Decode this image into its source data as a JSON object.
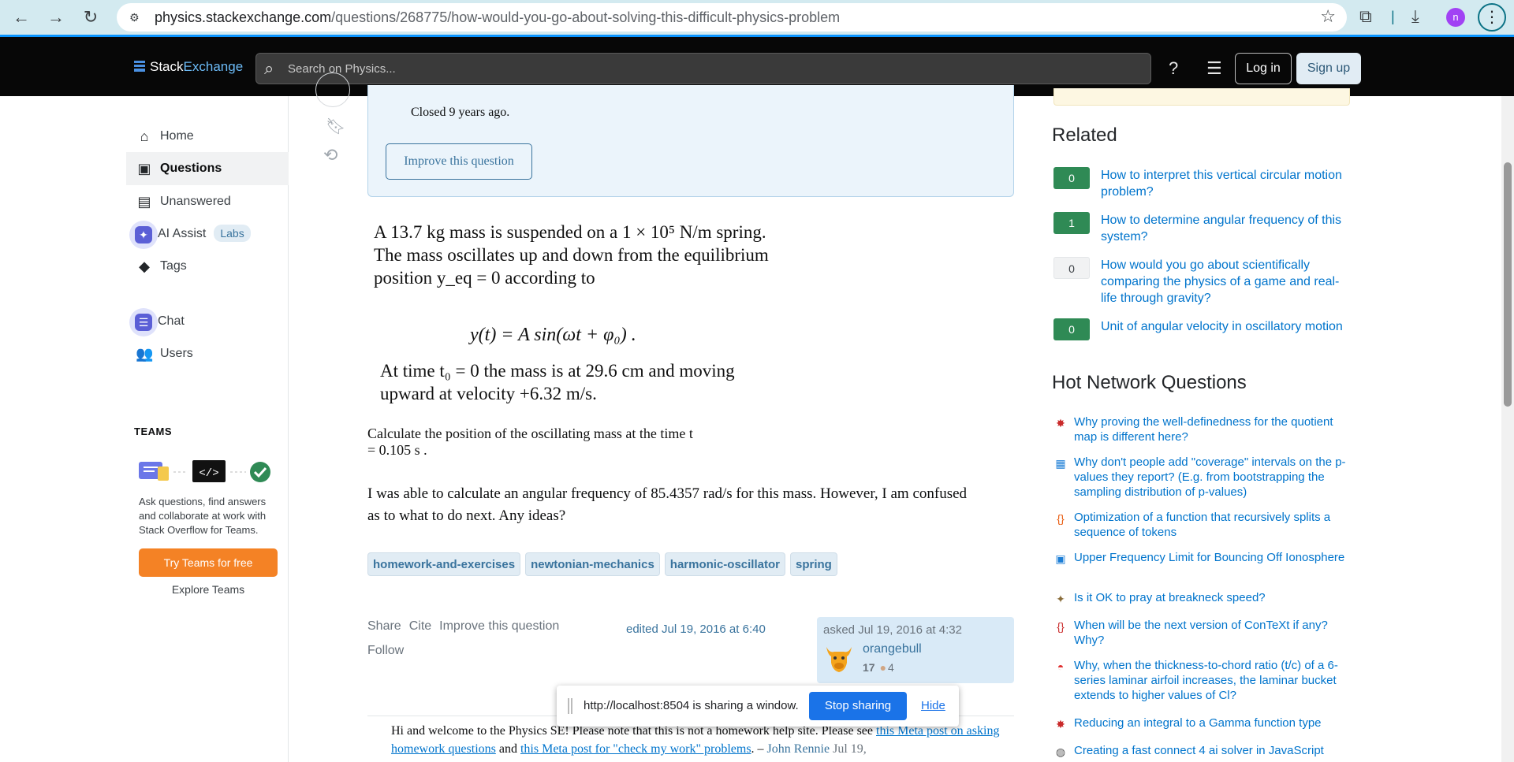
{
  "browser": {
    "url_domain": "physics.stackexchange.com",
    "url_path": "/questions/268775/how-would-you-go-about-solving-this-difficult-physics-problem",
    "profile_initial": "n"
  },
  "topbar": {
    "logo_stack": "Stack",
    "logo_exchange": "Exchange",
    "search_placeholder": "Search on Physics...",
    "login": "Log in",
    "signup": "Sign up"
  },
  "nav": {
    "home": "Home",
    "questions": "Questions",
    "unanswered": "Unanswered",
    "ai_assist": "AI Assist",
    "labs": "Labs",
    "tags": "Tags",
    "chat": "Chat",
    "users": "Users"
  },
  "teams": {
    "title": "TEAMS",
    "desc": "Ask questions, find answers and collaborate at work with Stack Overflow for Teams.",
    "try": "Try Teams for free",
    "explore": "Explore Teams"
  },
  "notice": {
    "closed": "Closed 9 years ago.",
    "improve": "Improve this question"
  },
  "question": {
    "img_p1": "A 13.7 kg mass is suspended on a 1 × 10⁵ N/m spring. The mass oscillates up and down from the equilibrium position y_eq = 0 according to",
    "img_eq": "y(t) = A sin(ωt + φ₀) .",
    "img_p2": "At time t₀ = 0 the mass is at 29.6 cm and moving upward at velocity +6.32 m/s.",
    "img_p3": "Calculate the position of the oscillating mass at the time t = 0.105 s .",
    "text": "I was able to calculate an angular frequency of 85.4357 rad/s for this mass. However, I am confused as to what to do next. Any ideas?",
    "tags": [
      "homework-and-exercises",
      "newtonian-mechanics",
      "harmonic-oscillator",
      "spring"
    ],
    "share": "Share",
    "cite": "Cite",
    "improve": "Improve this question",
    "follow": "Follow",
    "edited": "edited Jul 19, 2016 at 6:40",
    "asked": "asked Jul 19, 2016 at 4:32",
    "user": "orangebull",
    "rep": "17",
    "bronze": "4"
  },
  "comment": {
    "pre": "Hi and welcome to the Physics SE! Please note that this is not a homework help site. Please see ",
    "link1": "this Meta post on asking homework questions",
    "mid": " and ",
    "link2": "this Meta post for \"check my work\" problems",
    "dash": ". – ",
    "author": "John Rennie",
    "date": " Jul 19,"
  },
  "sharebar": {
    "msg": "http://localhost:8504 is sharing a window.",
    "stop": "Stop sharing",
    "hide": "Hide"
  },
  "related": {
    "title": "Related",
    "items": [
      {
        "score": "0",
        "title": "How to interpret this vertical circular motion problem?"
      },
      {
        "score": "1",
        "title": "How to determine angular frequency of this system?"
      },
      {
        "score": "0",
        "title": "How would you go about scientifically comparing the physics of a game and real-life through gravity?"
      },
      {
        "score": "0",
        "title": "Unit of angular velocity in oscillatory motion"
      }
    ]
  },
  "hot": {
    "title": "Hot Network Questions",
    "items": [
      {
        "title": "Why proving the well-definedness for the quotient map is different here?",
        "icon": "math-icon"
      },
      {
        "title": "Why don't people add \"coverage\" intervals on the p-values they report? (E.g. from bootstrapping the sampling distribution of p-values)",
        "icon": "stats-icon"
      },
      {
        "title": "Optimization of a function that recursively splits a sequence of tokens",
        "icon": "codereview-icon"
      },
      {
        "title": "Upper Frequency Limit for Bouncing Off Ionosphere",
        "icon": "ham-icon"
      },
      {
        "title": "Is it OK to pray at breakneck speed?",
        "icon": "judaism-icon"
      },
      {
        "title": "When will be the next version of ConTeXt if any? Why?",
        "icon": "tex-icon"
      },
      {
        "title": "Why, when the thickness-to-chord ratio (t/c) of a 6-series laminar airfoil increases, the laminar bucket extends to higher values of Cl?",
        "icon": "aviation-icon"
      },
      {
        "title": "Reducing an integral to a Gamma function type",
        "icon": "math-icon"
      },
      {
        "title": "Creating a fast connect 4 ai solver in JavaScript",
        "icon": "codegolf-icon"
      }
    ]
  }
}
